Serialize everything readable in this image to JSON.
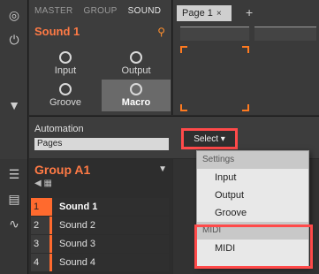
{
  "header": {
    "tabs": [
      "MASTER",
      "GROUP",
      "SOUND"
    ],
    "active_tab": "SOUND",
    "sound_name": "Sound 1"
  },
  "params": [
    {
      "label": "Input"
    },
    {
      "label": "Output"
    },
    {
      "label": "Groove"
    },
    {
      "label": "Macro"
    }
  ],
  "page": {
    "tab_label": "Page 1",
    "close": "×",
    "add": "+"
  },
  "automation": {
    "label": "Automation",
    "pages_value": "Pages",
    "select_label": "Select ▾"
  },
  "group": {
    "name": "Group A1",
    "sounds": [
      {
        "num": "1",
        "name": "Sound 1"
      },
      {
        "num": "2",
        "name": "Sound 2"
      },
      {
        "num": "3",
        "name": "Sound 3"
      },
      {
        "num": "4",
        "name": "Sound 4"
      }
    ]
  },
  "dropdown": {
    "section_settings": "Settings",
    "items_settings": [
      "Input",
      "Output",
      "Groove"
    ],
    "section_midi": "MIDI",
    "items_midi": [
      "MIDI"
    ]
  },
  "colors": {
    "accent": "#ff7a45",
    "highlight": "#ff4a4a"
  }
}
